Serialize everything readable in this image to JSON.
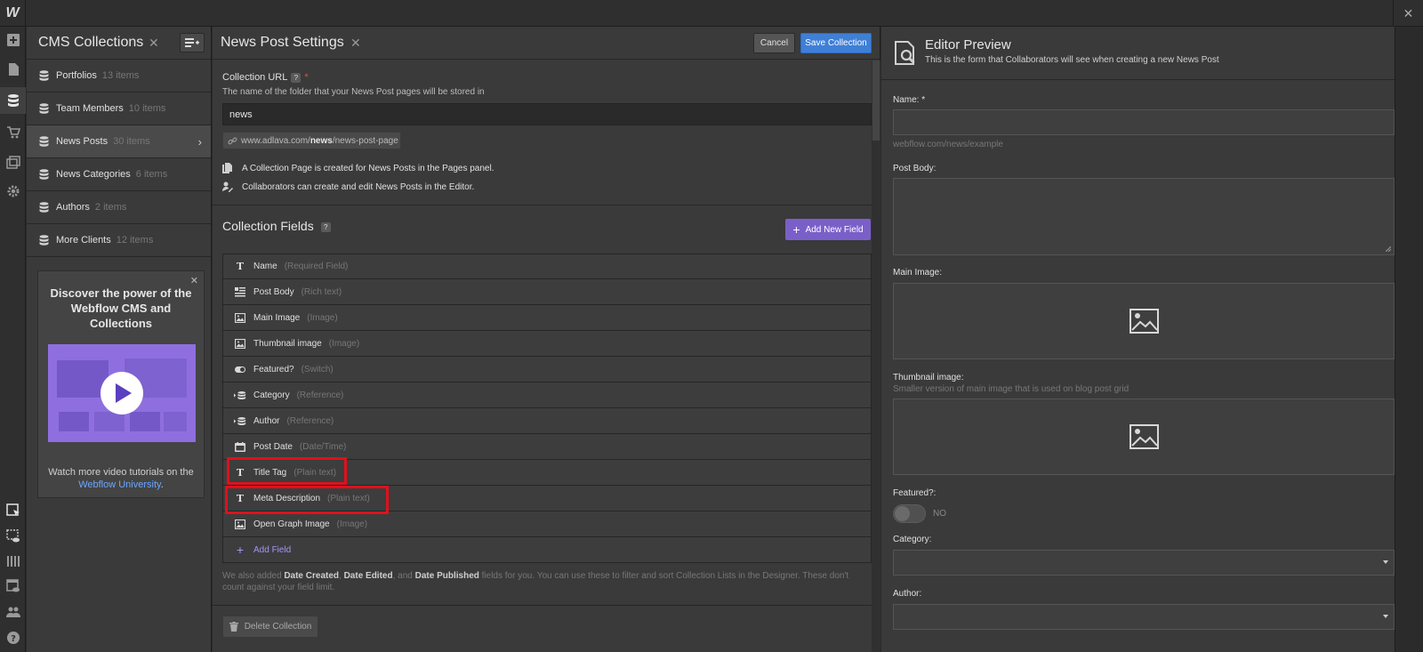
{
  "app": {
    "logo": "W",
    "close_glyph": "✕"
  },
  "leftbar": {
    "icons": [
      "add-icon",
      "pages-icon",
      "cms-icon",
      "ecommerce-icon",
      "assets-icon",
      "settings-icon",
      "select-icon",
      "preview-icon",
      "audit-icon",
      "editor-icon",
      "users-icon",
      "help-icon"
    ]
  },
  "cms": {
    "title": "CMS Collections",
    "close": "✕",
    "items": [
      {
        "name": "Portfolios",
        "count": "13 items"
      },
      {
        "name": "Team Members",
        "count": "10 items"
      },
      {
        "name": "News Posts",
        "count": "30 items"
      },
      {
        "name": "News Categories",
        "count": "6 items"
      },
      {
        "name": "Authors",
        "count": "2 items"
      },
      {
        "name": "More Clients",
        "count": "12 items"
      }
    ],
    "chevron": "›",
    "promo": {
      "close": "✕",
      "title": "Discover the power of the Webflow CMS and Collections",
      "foot_text": "Watch more video tutorials on the",
      "link_text": "Webflow University",
      "period": "."
    }
  },
  "settings": {
    "title": "News Post Settings",
    "close": "✕",
    "cancel_label": "Cancel",
    "save_label": "Save Collection",
    "collection_url_label": "Collection URL",
    "help_glyph": "?",
    "required_glyph": "*",
    "collection_url_desc": "The name of the folder that your News Post pages will be stored in",
    "collection_url_value": "news",
    "url_prefix": "www.adlava.com/",
    "url_folder": "news",
    "url_suffix": "/news-post-page",
    "info_page": "A Collection Page is created for News Posts in the Pages panel.",
    "info_editor": "Collaborators can create and edit News Posts in the Editor.",
    "fields_title": "Collection Fields",
    "add_new_field_label": "Add New Field",
    "plus_glyph": "+",
    "fields": [
      {
        "name": "Name",
        "type": "(Required Field)",
        "icon": "text-icon"
      },
      {
        "name": "Post Body",
        "type": "(Rich text)",
        "icon": "rich-text-icon"
      },
      {
        "name": "Main Image",
        "type": "(Image)",
        "icon": "image-icon"
      },
      {
        "name": "Thumbnail image",
        "type": "(Image)",
        "icon": "image-icon"
      },
      {
        "name": "Featured?",
        "type": "(Switch)",
        "icon": "switch-icon"
      },
      {
        "name": "Category",
        "type": "(Reference)",
        "icon": "reference-icon"
      },
      {
        "name": "Author",
        "type": "(Reference)",
        "icon": "reference-icon"
      },
      {
        "name": "Post Date",
        "type": "(Date/Time)",
        "icon": "calendar-icon"
      },
      {
        "name": "Title Tag",
        "type": "(Plain text)",
        "icon": "text-icon"
      },
      {
        "name": "Meta Description",
        "type": "(Plain text)",
        "icon": "text-icon"
      },
      {
        "name": "Open Graph Image",
        "type": "(Image)",
        "icon": "image-icon"
      }
    ],
    "add_field_label": "Add Field",
    "note": {
      "p1": "We also added ",
      "b1": "Date Created",
      "p2": ", ",
      "b2": "Date Edited",
      "p3": ", and ",
      "b3": "Date Published",
      "p4": " fields for you. You can use these to filter and sort Collection Lists in the Designer. These don't count against your field limit."
    },
    "delete_label": "Delete Collection"
  },
  "preview": {
    "title": "Editor Preview",
    "subtitle": "This is the form that Collaborators will see when creating a new News Post",
    "name_label": "Name: *",
    "name_hint": "webflow.com/news/example",
    "post_body_label": "Post Body:",
    "main_image_label": "Main Image:",
    "thumbnail_label": "Thumbnail image:",
    "thumbnail_hint": "Smaller version of main image that is used on blog post grid",
    "featured_label": "Featured?:",
    "toggle_state": "NO",
    "category_label": "Category:",
    "author_label": "Author:"
  },
  "colors": {
    "accent_blue": "#3f7fd6",
    "accent_purple": "#7b5fc9",
    "highlight_red": "#e0101c",
    "link_blue": "#6ba6ff"
  }
}
